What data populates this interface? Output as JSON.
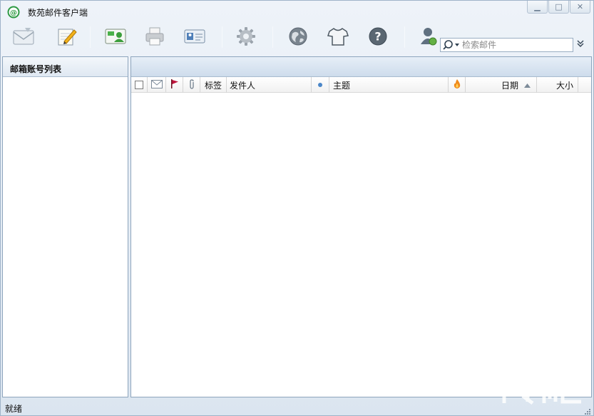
{
  "window": {
    "title": "数苑邮件客户端",
    "controls": [
      "minimize",
      "maximize",
      "close"
    ]
  },
  "toolbar": {
    "buttons": [
      {
        "icon": "receive-mail-icon"
      },
      {
        "icon": "compose-icon"
      },
      {
        "icon": "contacts-icon"
      },
      {
        "icon": "print-icon"
      },
      {
        "icon": "address-card-icon"
      },
      {
        "icon": "settings-gear-icon"
      },
      {
        "icon": "globe-icon"
      },
      {
        "icon": "skin-tshirt-icon"
      },
      {
        "icon": "help-icon"
      },
      {
        "icon": "account-user-icon"
      }
    ],
    "search": {
      "placeholder": "检索邮件",
      "value": ""
    }
  },
  "left_panel": {
    "header": "邮箱账号列表"
  },
  "message_list": {
    "columns": [
      {
        "key": "select",
        "label": ""
      },
      {
        "key": "read",
        "label": "",
        "icon": "envelope-icon"
      },
      {
        "key": "flag",
        "label": "",
        "icon": "flag-icon"
      },
      {
        "key": "attachment",
        "label": "",
        "icon": "paperclip-icon"
      },
      {
        "key": "tag",
        "label": "标签"
      },
      {
        "key": "sender",
        "label": "发件人"
      },
      {
        "key": "status",
        "label": "",
        "icon": "dot-icon"
      },
      {
        "key": "subject",
        "label": "主题"
      },
      {
        "key": "priority",
        "label": "",
        "icon": "fire-icon"
      },
      {
        "key": "date",
        "label": "日期",
        "sort": "ascending"
      },
      {
        "key": "size",
        "label": "大小"
      }
    ],
    "rows": []
  },
  "statusbar": {
    "text": "就绪"
  },
  "colors": {
    "accent": "#2a8f3f",
    "flag": "#c0143c",
    "frame": "#8ea5bd"
  }
}
